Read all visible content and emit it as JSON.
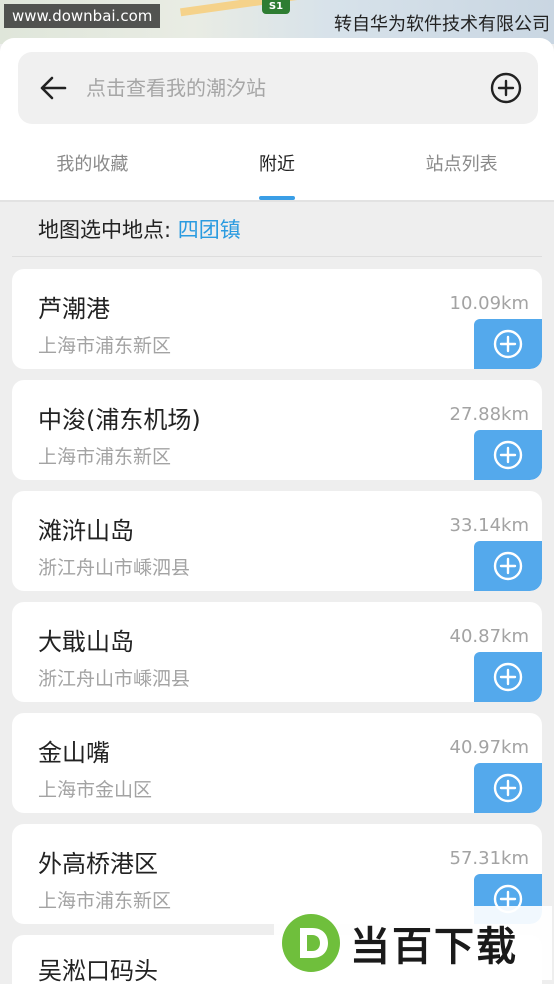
{
  "watermarks": {
    "site": "www.downbai.com",
    "credit": "转自华为软件技术有限公司",
    "road_shield": "S1",
    "brand": "当百下载"
  },
  "header": {
    "back_icon": "arrow-left-icon",
    "search_placeholder": "点击查看我的潮汐站",
    "add_icon": "circle-plus-icon"
  },
  "tabs": [
    {
      "label": "我的收藏",
      "active": false
    },
    {
      "label": "附近",
      "active": true
    },
    {
      "label": "站点列表",
      "active": false
    }
  ],
  "map_pick": {
    "label": "地图选中地点: ",
    "location": "四团镇"
  },
  "stations": [
    {
      "name": "芦潮港",
      "region": "上海市浦东新区",
      "distance": "10.09km"
    },
    {
      "name": "中浚(浦东机场)",
      "region": "上海市浦东新区",
      "distance": "27.88km"
    },
    {
      "name": "滩浒山岛",
      "region": "浙江舟山市嵊泗县",
      "distance": "33.14km"
    },
    {
      "name": "大戢山岛",
      "region": "浙江舟山市嵊泗县",
      "distance": "40.87km"
    },
    {
      "name": "金山嘴",
      "region": "上海市金山区",
      "distance": "40.97km"
    },
    {
      "name": "外高桥港区",
      "region": "上海市浦东新区",
      "distance": "57.31km"
    },
    {
      "name": "吴淞口码头",
      "region": "",
      "distance": ""
    }
  ],
  "colors": {
    "accent": "#3a9ee6",
    "add_button": "#54a9ec",
    "location_text": "#2a9be0",
    "background": "#eeeeee"
  }
}
